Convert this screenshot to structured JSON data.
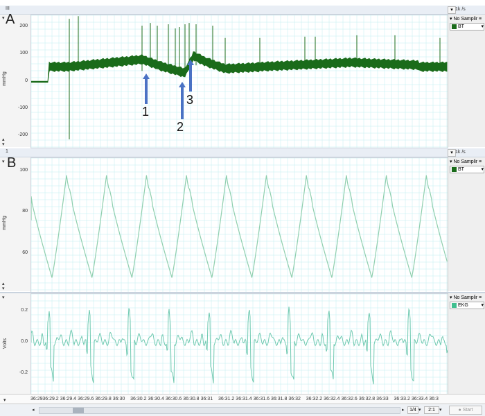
{
  "panelA": {
    "letter": "A",
    "top_indicator": "III",
    "rate": "1k /s",
    "sampling": "No Samplir",
    "channel": "BT",
    "channel_color": "#1a6b1a",
    "ylabel": "mmHg",
    "yticks": [
      "200",
      "100",
      "0",
      "-100",
      "-200"
    ],
    "annotations": [
      "1",
      "2",
      "3"
    ],
    "arrow_color": "#4a72c4"
  },
  "panelB": {
    "letter": "B",
    "top_indicator": "1",
    "rate": "1k /s",
    "sampling": "No Samplir",
    "channel": "BT",
    "channel_color": "#1a6b1a",
    "ylabel": "mmHg",
    "yticks": [
      "100",
      "80",
      "60"
    ]
  },
  "panelC": {
    "sampling": "No Samplir",
    "channel": "EKG",
    "channel_color": "#3fbf8f",
    "ylabel": "Volts",
    "yticks": [
      "0.2",
      "0.0",
      "-0.2"
    ]
  },
  "xaxis": {
    "ticks": [
      "36:29",
      "36:29.2",
      "36:29.4",
      "36:29.6",
      "36:29.8",
      "36:30",
      "36:30.2",
      "36:30.4",
      "36:30.6",
      "36:30.8",
      "36:31",
      "36:31.2",
      "36:31.4",
      "36:31.6",
      "36:31.8",
      "36:32",
      "36:32.2",
      "36:32.4",
      "36:32.6",
      "36:32.8",
      "36:33",
      "36:33.2",
      "36:33.4",
      "36:3"
    ]
  },
  "footer": {
    "zoom_a": "1/4",
    "zoom_b": "2:1",
    "start_label": "Start"
  },
  "colors": {
    "grid": "#bfeef0",
    "trace_bp_overview": "#1a6b1a",
    "trace_bp_detail": "#8fcfae",
    "trace_ekg": "#6fc9b0"
  }
}
